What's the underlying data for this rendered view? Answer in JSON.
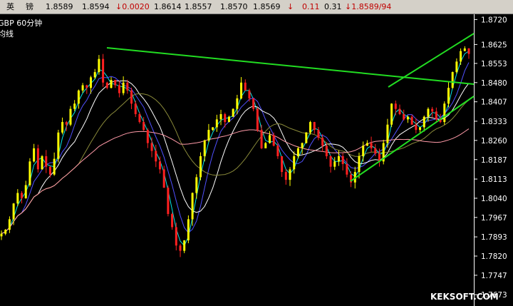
{
  "quote_bar": {
    "name_part1": "英",
    "name_part2": "镑",
    "last": "1.8589",
    "ask": "1.8594",
    "change": "↓0.0020",
    "open": "1.8614",
    "low": "1.8557",
    "prev": "1.8570",
    "high": "1.8569",
    "arrow": "↓",
    "range": "0.11",
    "pct": "0.31",
    "bid_ask": "↓1.8589/94"
  },
  "watermark": "KEKSOFT.COM",
  "colors": {
    "background": "#000000",
    "up_candle": "#ffff00",
    "down_candle": "#ff2020",
    "trendline": "#22dd22",
    "ma_fast": "#00e5e5",
    "ma_mid": "#ffffff",
    "ma_blue": "#5050ff",
    "ma_olive": "#8a8a3a",
    "ma_pink": "#ff9aa8",
    "price_down": "#c00000"
  },
  "chart_data": {
    "type": "line",
    "title": "GBP 60分钟",
    "subtitle": "均线",
    "ylim": [
      1.763,
      1.874
    ],
    "y_ticks": [
      1.872,
      1.8625,
      1.8553,
      1.848,
      1.8407,
      1.8333,
      1.826,
      1.8187,
      1.8113,
      1.804,
      1.7967,
      1.7893,
      1.782,
      1.7747,
      1.7673
    ],
    "grid": false,
    "series": [
      {
        "values": [
          1.7905,
          1.792,
          1.796,
          1.802,
          1.806,
          1.804,
          1.809,
          1.818,
          1.823,
          1.815,
          1.82,
          1.816,
          1.813,
          1.819,
          1.829,
          1.833,
          1.832,
          1.838,
          1.84,
          1.845,
          1.847,
          1.846,
          1.85,
          1.852,
          1.857,
          1.848,
          1.846,
          1.849,
          1.847,
          1.844,
          1.848,
          1.845,
          1.84,
          1.836,
          1.833,
          1.83,
          1.825,
          1.822,
          1.818,
          1.815,
          1.808,
          1.798,
          1.793,
          1.786,
          1.784,
          1.788,
          1.796,
          1.806,
          1.812,
          1.82,
          1.826,
          1.83,
          1.831,
          1.834,
          1.836,
          1.833,
          1.835,
          1.838,
          1.842,
          1.848,
          1.845,
          1.842,
          1.838,
          1.83,
          1.823,
          1.825,
          1.828,
          1.824,
          1.82,
          1.814,
          1.811,
          1.815,
          1.82,
          1.823,
          1.825,
          1.829,
          1.833,
          1.83,
          1.827,
          1.824,
          1.82,
          1.816,
          1.818,
          1.82,
          1.817,
          1.813,
          1.81,
          1.814,
          1.82,
          1.824,
          1.825,
          1.823,
          1.821,
          1.818,
          1.825,
          1.832,
          1.84,
          1.838,
          1.836,
          1.834,
          1.835,
          1.832,
          1.83,
          1.831,
          1.835,
          1.838,
          1.837,
          1.834,
          1.833,
          1.84,
          1.846,
          1.852,
          1.856,
          1.86,
          1.861,
          1.8589
        ]
      }
    ]
  }
}
